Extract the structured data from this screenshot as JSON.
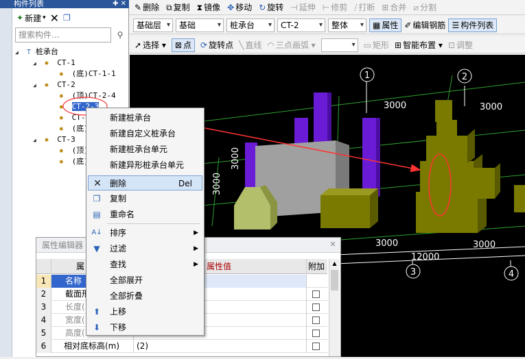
{
  "left_panel": {
    "title": "构件列表",
    "pin_icon": "pin-icon",
    "new_label": "新建",
    "search_placeholder": "搜索构件...",
    "tree": {
      "root": "桩承台",
      "ct1": "CT-1",
      "ct1_child": "(底)CT-1-1",
      "ct2": "CT-2",
      "ct2_child1": "(顶)CT-2-4",
      "ct2_child2": "CT-2-3",
      "ct2_child3": "CT-2",
      "ct2_child4": "(底)",
      "ct3": "CT-3",
      "ct3_child1": "(顶)",
      "ct3_child2": "(底)"
    }
  },
  "toolbar1": {
    "delete": "删除",
    "copy": "复制",
    "mirror": "镜像",
    "move": "移动",
    "rotate": "旋转",
    "extend": "延伸",
    "trim": "修剪",
    "break": "打断",
    "merge": "合并",
    "split": "分割"
  },
  "toolbar2": {
    "layer": "基础层",
    "category": "基础",
    "type": "桩承台",
    "component": "CT-2",
    "scope": "整体",
    "properties": "属性",
    "edit_rebar": "编辑钢筋",
    "component_list": "构件列表"
  },
  "toolbar3": {
    "select": "选择",
    "point": "点",
    "rotate_point": "旋转点",
    "line": "直线",
    "three_point_arc": "三点画弧",
    "rectangle": "矩形",
    "smart_layout": "智能布置",
    "adjust": "调整"
  },
  "view3d": {
    "axis_labels": [
      "1",
      "2",
      "3",
      "4"
    ],
    "dims": [
      "3000",
      "3000",
      "3000",
      "3000",
      "3000",
      "3000",
      "12000"
    ]
  },
  "property_editor": {
    "title": "属性编辑器",
    "col_name": "属",
    "col_value": "属性值",
    "col_extra": "附加",
    "rows": [
      {
        "num": "1",
        "name": "名称",
        "value": ""
      },
      {
        "num": "2",
        "name": "截面形",
        "value": ""
      },
      {
        "num": "3",
        "name": "长度(",
        "value": ""
      },
      {
        "num": "4",
        "name": "宽度(",
        "value": ""
      },
      {
        "num": "5",
        "name": "高度(",
        "value": ""
      },
      {
        "num": "6",
        "name": "相对底标高(m)",
        "value": "(2)"
      }
    ]
  },
  "context_menu": {
    "items": [
      {
        "label": "新建桩承台",
        "icon": ""
      },
      {
        "label": "新建自定义桩承台",
        "icon": ""
      },
      {
        "label": "新建桩承台单元",
        "icon": ""
      },
      {
        "label": "新建异形桩承台单元",
        "icon": ""
      },
      {
        "label": "删除",
        "icon": "delete-icon",
        "shortcut": "Del"
      },
      {
        "label": "复制",
        "icon": "copy-icon"
      },
      {
        "label": "重命名",
        "icon": "rename-icon"
      },
      {
        "label": "排序",
        "icon": "sort-icon"
      },
      {
        "label": "过滤",
        "icon": "filter-icon"
      },
      {
        "label": "查找",
        "icon": ""
      },
      {
        "label": "全部展开",
        "icon": ""
      },
      {
        "label": "全部折叠",
        "icon": ""
      },
      {
        "label": "上移",
        "icon": "arrow-up-icon"
      },
      {
        "label": "下移",
        "icon": "arrow-down-icon"
      }
    ]
  },
  "colors": {
    "accent": "#2b579a",
    "annotation_red": "#ff3333",
    "olive": "#7a7a00",
    "purple": "#6a1bd6",
    "grid_green": "#2fa02f"
  }
}
